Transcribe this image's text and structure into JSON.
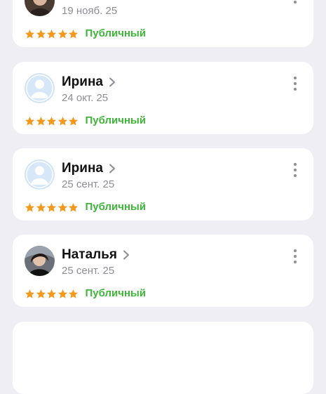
{
  "reviews": [
    {
      "name": "",
      "date": "19 нояб. 25",
      "status": "Публичный",
      "rating": 5,
      "avatar": "photo-avatar"
    },
    {
      "name": "Ирина",
      "date": "24 окт. 25",
      "status": "Публичный",
      "rating": 5,
      "avatar": "default-user-avatar"
    },
    {
      "name": "Ирина",
      "date": "25 сент. 25",
      "status": "Публичный",
      "rating": 5,
      "avatar": "default-user-avatar"
    },
    {
      "name": "Наталья",
      "date": "25 сент. 25",
      "status": "Публичный",
      "rating": 5,
      "avatar": "photo-avatar"
    }
  ],
  "colors": {
    "background": "#eeeef4",
    "card": "#ffffff",
    "star": "#f39a1e",
    "status_public": "#3fb53a",
    "secondary_text": "#8d8d93",
    "placeholder_avatar": "#cfe3f7"
  },
  "icons": {
    "star": "star-icon",
    "chevron": "chevron-right-icon",
    "more": "more-vertical-icon"
  }
}
